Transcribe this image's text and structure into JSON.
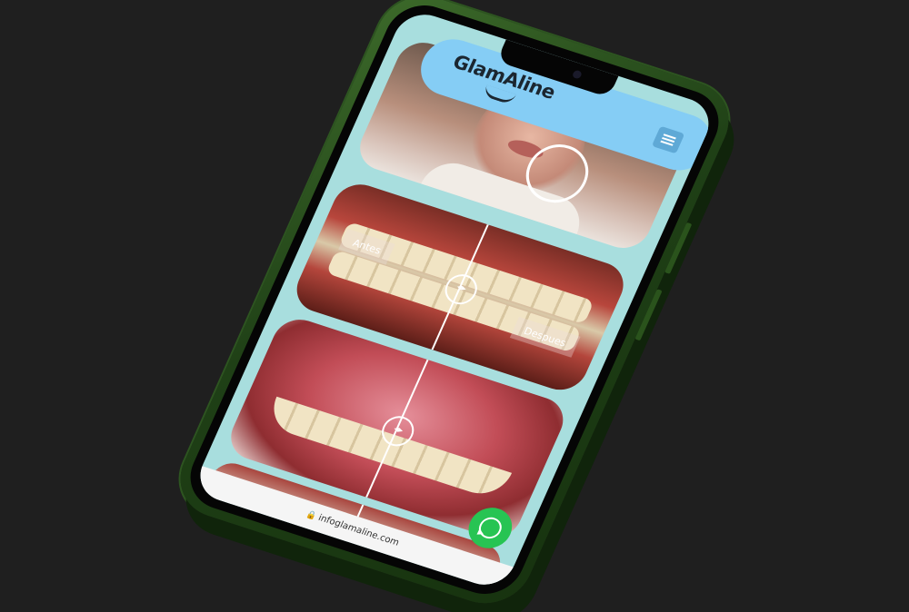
{
  "header": {
    "logo_text": "GlamAline",
    "menu_icon": "hamburger-icon"
  },
  "comparison": {
    "before_label": "Antes",
    "after_label": "Despues"
  },
  "browser": {
    "url": "infoglamaline.com"
  },
  "floating": {
    "whatsapp_icon": "whatsapp-icon"
  },
  "colors": {
    "header_bg": "#85cdf5",
    "page_bg": "#a8dede",
    "phone_frame": "#2d5520",
    "whatsapp_green": "#27c453"
  }
}
